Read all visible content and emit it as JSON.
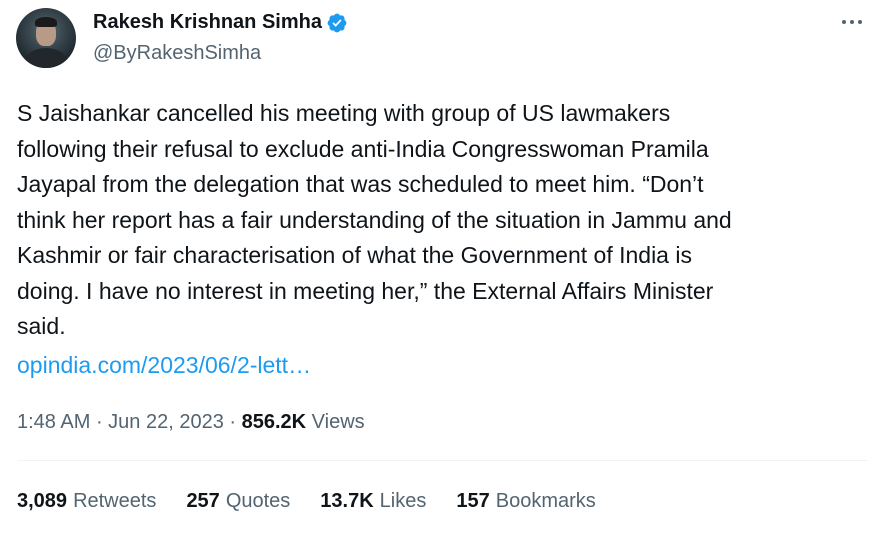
{
  "author": {
    "name": "Rakesh Krishnan Simha",
    "handle": "@ByRakeshSimha"
  },
  "tweet": {
    "text": "S Jaishankar cancelled his meeting with group of US lawmakers\nfollowing their refusal to exclude anti-India Congresswoman Pramila\nJayapal from the delegation that was scheduled to meet him. “Don’t\nthink her report has a fair understanding of the situation in Jammu and\nKashmir or fair characterisation of what the Government of India is\ndoing. I have no interest in meeting her,” the External Affairs Minister\nsaid.",
    "link": "opindia.com/2023/06/2-lett…"
  },
  "meta": {
    "time": "1:48 AM",
    "sep1": " · ",
    "date": "Jun 22, 2023",
    "sep2": " · ",
    "views_count": "856.2K",
    "views_label": "Views"
  },
  "stats": [
    {
      "count": "3,089",
      "label": "Retweets"
    },
    {
      "count": "257",
      "label": "Quotes"
    },
    {
      "count": "13.7K",
      "label": "Likes"
    },
    {
      "count": "157",
      "label": "Bookmarks"
    }
  ],
  "icons": {
    "verified": "verified-badge-icon",
    "more": "more-horizontal-icon"
  },
  "colors": {
    "accent": "#1d9bf0",
    "text": "#0f1419",
    "secondary": "#536471"
  }
}
